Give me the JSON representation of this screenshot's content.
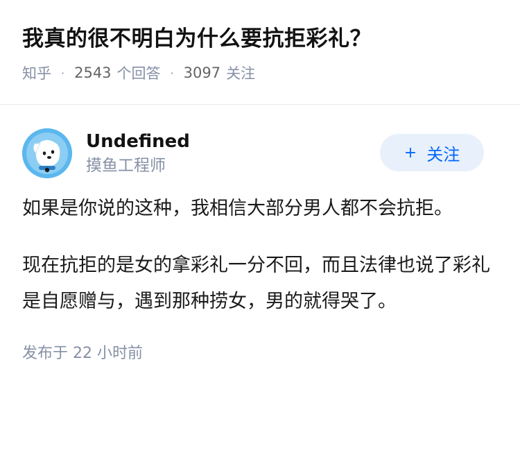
{
  "question": {
    "title": "我真的很不明白为什么要抗拒彩礼？",
    "source": "知乎",
    "answers_count": "2543",
    "answers_label": "个回答",
    "followers_count": "3097",
    "followers_label": "关注"
  },
  "answer": {
    "author_name": "Undefined",
    "author_title": "摸鱼工程师",
    "follow_icon": "+",
    "follow_label": "关注",
    "paragraphs": [
      "如果是你说的这种，我相信大部分男人都不会抗拒。",
      "现在抗拒的是女的拿彩礼一分不回，而且法律也说了彩礼是自愿赠与，遇到那种捞女，男的就得哭了。"
    ],
    "time_label": "发布于",
    "time_value": "22 小时前"
  }
}
